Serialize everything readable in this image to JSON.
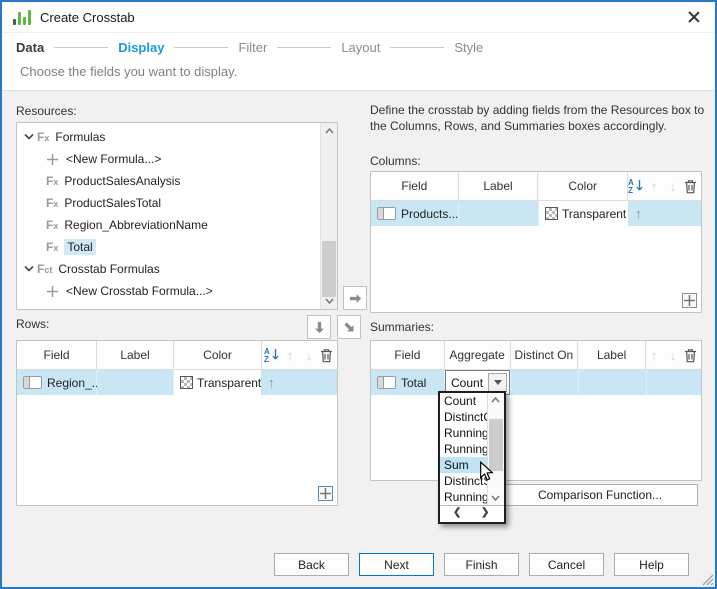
{
  "window": {
    "title": "Create Crosstab"
  },
  "wizard": {
    "steps": [
      "Data",
      "Display",
      "Filter",
      "Layout",
      "Style"
    ],
    "active_step": "Display",
    "subtitle": "Choose the fields you want to display."
  },
  "panels": {
    "resources": {
      "label": "Resources:",
      "tree": [
        {
          "label": "Formulas",
          "icon": "fx-group",
          "type": "group",
          "expanded": true
        },
        {
          "label": "<New Formula...>",
          "icon": "plus",
          "type": "child"
        },
        {
          "label": "ProductSalesAnalysis",
          "icon": "fx",
          "type": "child"
        },
        {
          "label": "ProductSalesTotal",
          "icon": "fx",
          "type": "child"
        },
        {
          "label": "Region_AbbreviationName",
          "icon": "fx",
          "type": "child"
        },
        {
          "label": "Total",
          "icon": "fx",
          "type": "child",
          "selected": true
        },
        {
          "label": "Crosstab Formulas",
          "icon": "fct-group",
          "type": "group",
          "expanded": true
        },
        {
          "label": "<New Crosstab Formula...>",
          "icon": "plus",
          "type": "child"
        }
      ]
    },
    "instructions": "Define the crosstab by adding fields from the Resources box to the Columns, Rows, and Summaries boxes accordingly.",
    "columns": {
      "label": "Columns:",
      "headers": {
        "field": "Field",
        "label": "Label",
        "color": "Color"
      },
      "row": {
        "field": "Products...",
        "label": "",
        "color": "Transparent",
        "sort": "ascending"
      }
    },
    "rows": {
      "label": "Rows:",
      "headers": {
        "field": "Field",
        "label": "Label",
        "color": "Color"
      },
      "row": {
        "field": "Region_...",
        "label": "",
        "color": "Transparent",
        "sort": "ascending"
      }
    },
    "summaries": {
      "label": "Summaries:",
      "headers": {
        "field": "Field",
        "aggregate": "Aggregate",
        "distinct_on": "Distinct On",
        "label": "Label"
      },
      "row": {
        "field": "Total",
        "aggregate": "Count",
        "distinct_on": "",
        "label": ""
      },
      "comparison_button": "Comparison Function..."
    }
  },
  "aggregate_dropdown": {
    "items": [
      "Count",
      "DistinctC",
      "RunningC",
      "RunningD",
      "Sum",
      "DistinctS",
      "RunningS"
    ],
    "hovered_item": "Sum"
  },
  "footer": {
    "buttons": [
      "Back",
      "Next",
      "Finish",
      "Cancel",
      "Help"
    ],
    "default_button": "Next"
  },
  "icons": {
    "app": "green-bar-chart-icon",
    "close": "close-icon",
    "sort": "sort-az-icon",
    "move_up": "arrow-up-icon",
    "move_down": "arrow-down-icon",
    "delete": "trash-icon",
    "add": "plus-icon",
    "transfer_right": "arrow-right-icon",
    "transfer_down": "arrow-down-icon",
    "transfer_corner": "arrow-down-right-icon"
  },
  "colors": {
    "dialog_border": "#2878c8",
    "accent_blue": "#1a9ae0",
    "selection_blue": "#c9e6f5",
    "icon_green": "#61b746"
  }
}
